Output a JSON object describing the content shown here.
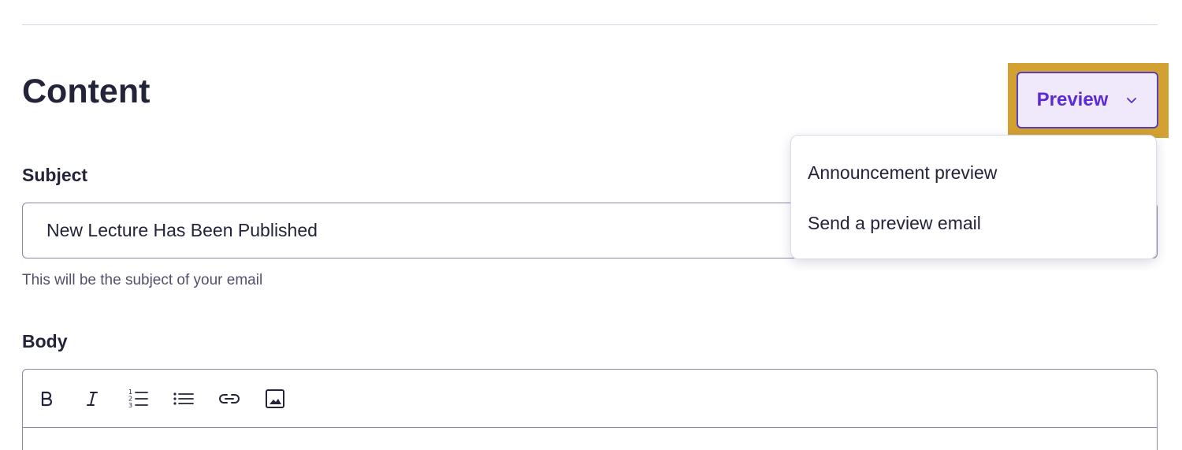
{
  "content": {
    "title": "Content",
    "preview_button_label": "Preview",
    "preview_menu": [
      {
        "label": "Announcement preview"
      },
      {
        "label": "Send a preview email"
      }
    ],
    "subject": {
      "label": "Subject",
      "value": "New Lecture Has Been Published",
      "help_text": "This will be the subject of your email"
    },
    "body": {
      "label": "Body",
      "toolbar": [
        {
          "icon": "bold-icon"
        },
        {
          "icon": "italic-icon"
        },
        {
          "icon": "numbered-list-icon"
        },
        {
          "icon": "bullet-list-icon"
        },
        {
          "icon": "link-icon"
        },
        {
          "icon": "image-icon"
        }
      ]
    }
  },
  "colors": {
    "highlight": "#d3a131",
    "accent": "#5b2ad6",
    "button_bg": "#efe9fb",
    "text": "#23233a"
  }
}
